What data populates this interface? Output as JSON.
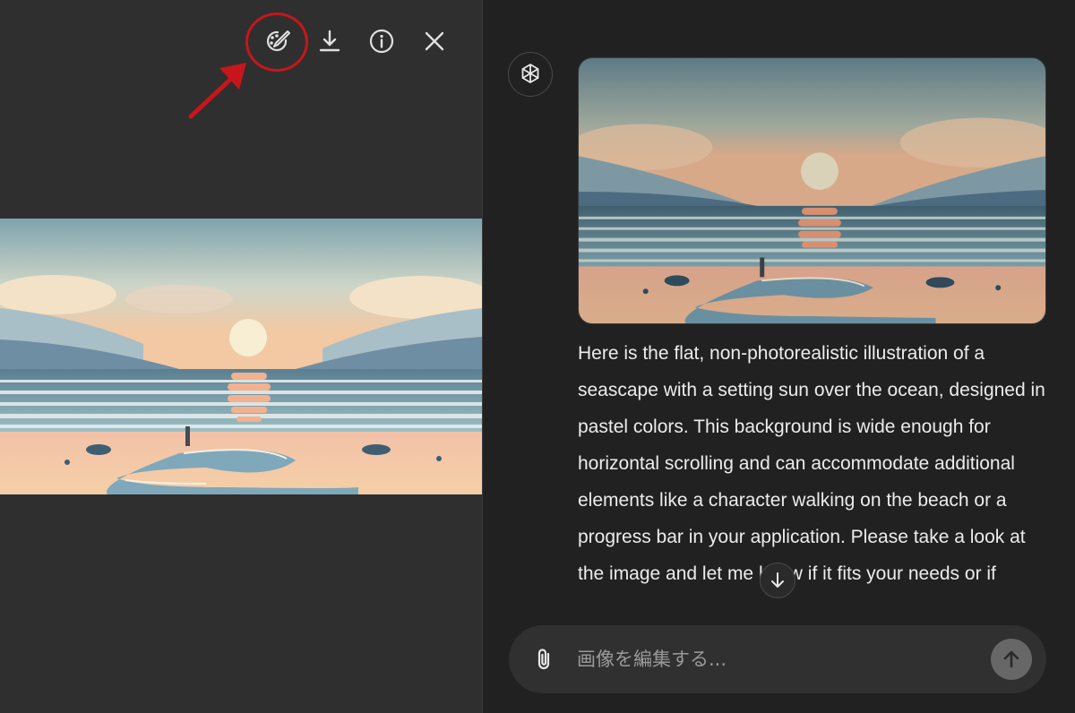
{
  "viewer": {
    "toolbar": {
      "edit_icon": "edit-brush-icon",
      "download_icon": "download-icon",
      "info_icon": "info-icon",
      "close_icon": "close-icon"
    },
    "annotation": {
      "highlight_color": "#c8151b"
    }
  },
  "chat": {
    "assistant_icon": "openai-logo-icon",
    "message": "Here is the flat, non-photorealistic illustration of a seascape with a setting sun over the ocean, designed in pastel colors. This background is wide enough for horizontal scrolling and can accommodate additional elements like a character walking on the beach or a progress bar in your application. Please take a look at the image and let me know if it fits your needs or if",
    "composer": {
      "placeholder": "画像を編集する...",
      "attach_icon": "paperclip-icon",
      "send_icon": "arrow-up-icon"
    },
    "scroll_icon": "arrow-down-icon"
  },
  "colors": {
    "background": "#212121",
    "viewer_background": "#2f2f2f",
    "composer_background": "#303030",
    "send_button": "#676767"
  }
}
